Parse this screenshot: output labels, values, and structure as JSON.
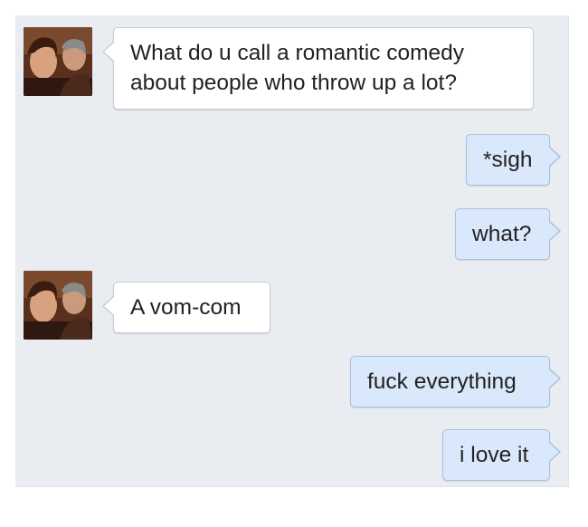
{
  "conversation": {
    "messages": [
      {
        "direction": "incoming",
        "avatar": "contact-photo",
        "text_lines": [
          "What do u call a romantic comedy",
          "about people who throw up a lot?"
        ]
      },
      {
        "direction": "outgoing",
        "text": "*sigh"
      },
      {
        "direction": "outgoing",
        "text": "what?"
      },
      {
        "direction": "incoming",
        "avatar": "contact-photo",
        "text": "A vom-com"
      },
      {
        "direction": "outgoing",
        "text": "fuck everything"
      },
      {
        "direction": "outgoing",
        "text": "i love it"
      }
    ]
  },
  "colors": {
    "background": "#e9edf2",
    "incoming_bubble": "#ffffff",
    "outgoing_bubble": "#d9e8fa"
  }
}
